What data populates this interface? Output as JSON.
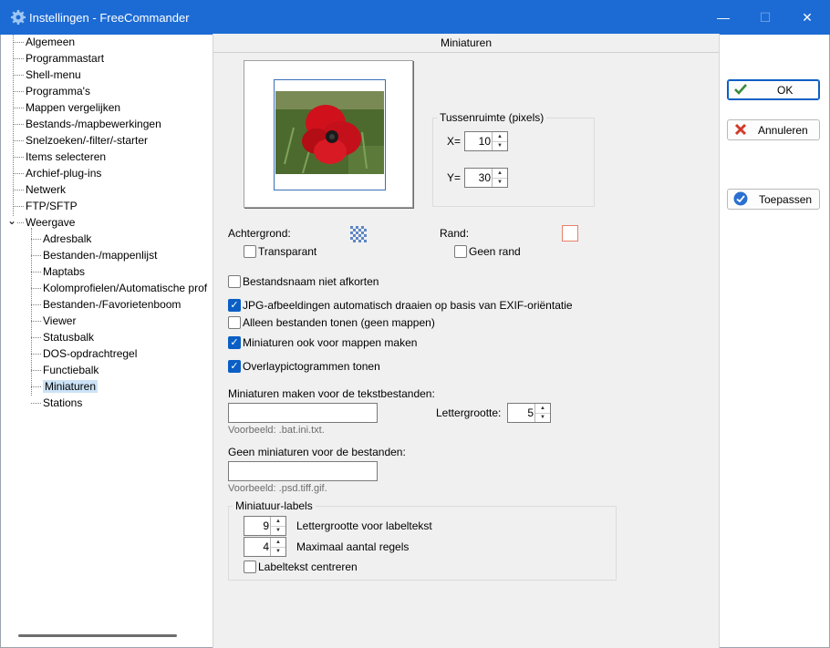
{
  "window": {
    "title": "Instellingen - FreeCommander",
    "minimize": "—",
    "maximize": "☐",
    "close": "✕"
  },
  "tree": {
    "items": [
      "Algemeen",
      "Programmastart",
      "Shell-menu",
      "Programma's",
      "Mappen vergelijken",
      "Bestands-/mapbewerkingen",
      "Snelzoeken/-filter/-starter",
      "Items selecteren",
      "Archief-plug-ins",
      "Netwerk",
      "FTP/SFTP",
      "Weergave"
    ],
    "expand_glyph": "⌄",
    "children": [
      "Adresbalk",
      "Bestanden-/mappenlijst",
      "Maptabs",
      "Kolomprofielen/Automatische prof",
      "Bestanden-/Favorietenboom",
      "Viewer",
      "Statusbalk",
      "DOS-opdrachtregel",
      "Functiebalk",
      "Miniaturen",
      "Stations"
    ],
    "selected": "Miniaturen"
  },
  "panel": {
    "header": "Miniaturen",
    "spacing": {
      "legend": "Tussenruimte (pixels)",
      "x_label": "X=",
      "x_value": "10",
      "y_label": "Y=",
      "y_value": "30"
    },
    "background_label": "Achtergrond:",
    "transparent_label": "Transparant",
    "border_label": "Rand:",
    "no_border_label": "Geen rand",
    "options": [
      {
        "label": "Bestandsnaam niet afkorten",
        "checked": false
      },
      {
        "label": "JPG-afbeeldingen automatisch draaien op basis van EXIF-oriëntatie",
        "checked": true
      },
      {
        "label": "Alleen bestanden tonen (geen mappen)",
        "checked": false
      },
      {
        "label": "Miniaturen ook voor mappen maken",
        "checked": true
      },
      {
        "label": "Overlaypictogrammen tonen",
        "checked": true
      }
    ],
    "text_files_label": "Miniaturen maken voor de tekstbestanden:",
    "text_files_value": "",
    "text_files_hint": "Voorbeeld: .bat.ini.txt.",
    "font_size_label": "Lettergrootte:",
    "font_size_value": "5",
    "exclude_label": "Geen miniaturen voor de bestanden:",
    "exclude_value": "",
    "exclude_hint": "Voorbeeld: .psd.tiff.gif.",
    "labels_group": {
      "legend": "Miniatuur-labels",
      "font_size_value": "9",
      "font_size_label": "Lettergrootte voor labeltekst",
      "max_lines_value": "4",
      "max_lines_label": "Maximaal aantal regels",
      "center_label": "Labeltekst centreren"
    }
  },
  "buttons": {
    "ok": "OK",
    "cancel": "Annuleren",
    "apply": "Toepassen"
  },
  "colors": {
    "titlebar": "#1c6bd5",
    "accent": "#0a5fc4",
    "selection": "#cce3f7",
    "border_swatch": "#e8806a"
  }
}
